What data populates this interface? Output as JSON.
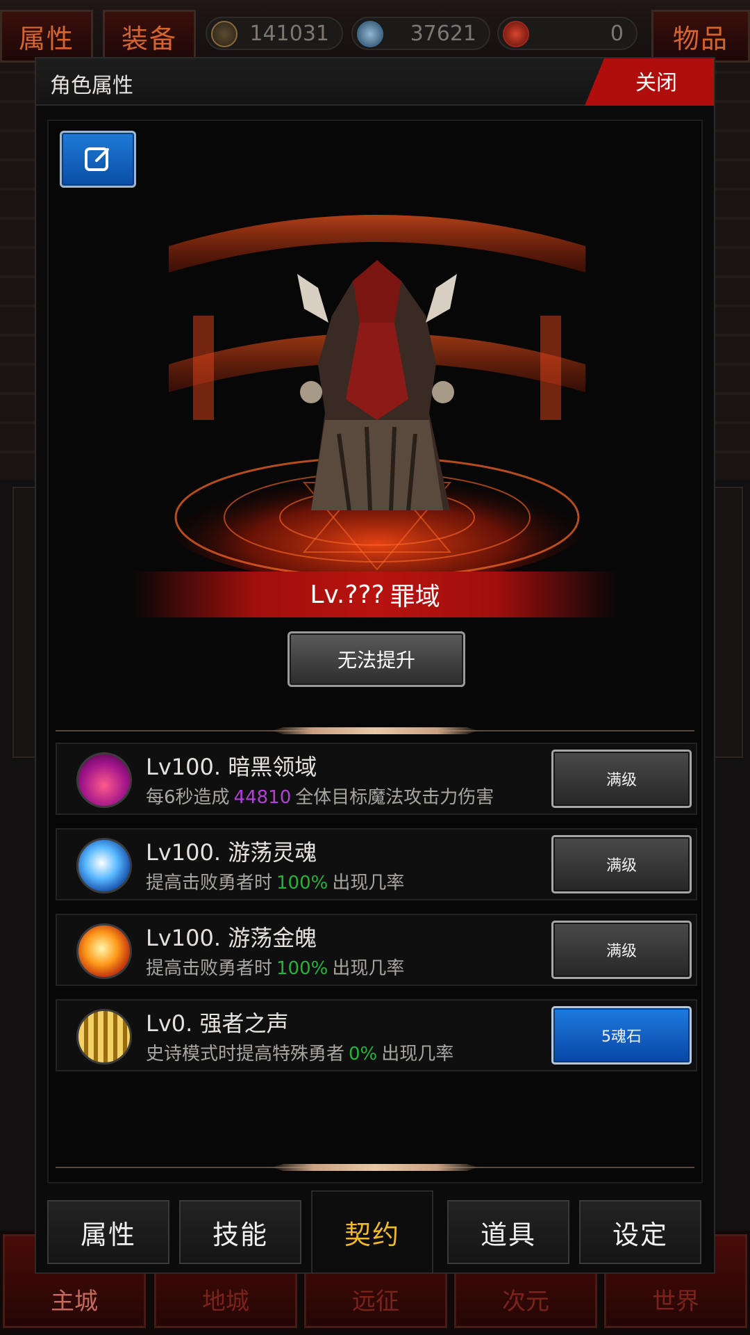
{
  "top_bar": {
    "tab_attributes": "属性",
    "tab_equipment": "装备",
    "tab_items": "物品",
    "currency": [
      {
        "icon": "star-coin-icon",
        "value": "141031",
        "color": "#8a6a3a"
      },
      {
        "icon": "skull-coin-icon",
        "value": "37621",
        "color": "#3d6d8f"
      },
      {
        "icon": "soul-gem-icon",
        "value": "0",
        "color": "#a3261c"
      }
    ]
  },
  "bottom_nav": {
    "items": [
      "主城",
      "地城",
      "远征",
      "次元",
      "世界"
    ]
  },
  "modal": {
    "title": "角色属性",
    "close_label": "关闭",
    "character": {
      "level": "Lv.???",
      "name": "罪域"
    },
    "upgrade_label": "无法提升",
    "skills": [
      {
        "icon": "dark-domain-icon",
        "name": "Lv100. 暗黑领域",
        "desc_pre": "每6秒造成",
        "desc_value": "44810",
        "desc_post": "全体目标魔法攻击力伤害",
        "value_color": "#b23fd6",
        "button": "满级"
      },
      {
        "icon": "wandering-soul-icon",
        "name": "Lv100. 游荡灵魂",
        "desc_pre": "提高击败勇者时",
        "desc_value": "100%",
        "desc_post": "出现几率",
        "value_color": "#26b33a",
        "button": "满级"
      },
      {
        "icon": "wandering-gold-soul-icon",
        "name": "Lv100. 游荡金魄",
        "desc_pre": "提高击败勇者时",
        "desc_value": "100%",
        "desc_post": "出现几率",
        "value_color": "#26b33a",
        "button": "满级"
      },
      {
        "icon": "voice-of-strong-icon",
        "name": "Lv0. 强者之声",
        "desc_pre": "史诗模式时提高特殊勇者",
        "desc_value": "0%",
        "desc_post": "出现几率",
        "value_color": "#26b33a",
        "button": "5魂石"
      }
    ],
    "tabs": [
      "属性",
      "技能",
      "契约",
      "道具",
      "设定"
    ],
    "active_tab": "契约"
  },
  "colors": {
    "close_red": "#b00d0d",
    "active_tab_gold": "#f0b92b",
    "purple_value": "#b23fd6",
    "green_value": "#26b33a",
    "button_blue": "#0b5fc4"
  }
}
